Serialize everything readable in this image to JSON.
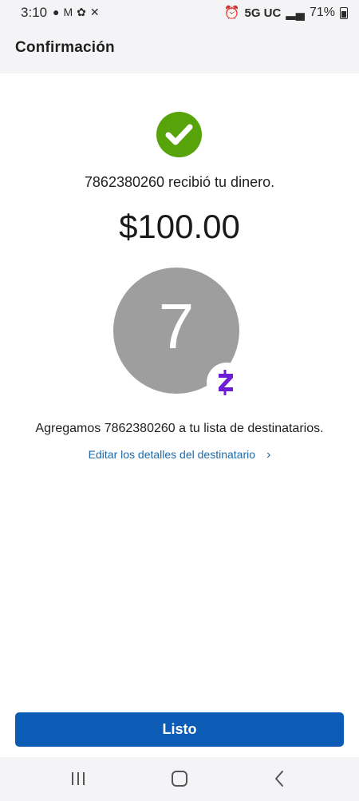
{
  "status_bar": {
    "time": "3:10",
    "network": "5G UC",
    "battery": "71%"
  },
  "header": {
    "title": "Confirmación"
  },
  "confirmation": {
    "received_text": "7862380260 recibió tu dinero.",
    "amount": "$100.00",
    "avatar_initial": "7",
    "added_text": "Agregamos 7862380260 a tu lista de destinatarios.",
    "edit_link": "Editar los detalles del destinatario",
    "done_button": "Listo"
  },
  "colors": {
    "success": "#56a30a",
    "primary": "#0c5bb5",
    "link": "#1e6aa8",
    "zelle_purple": "#6d1ed4",
    "avatar": "#9e9e9e"
  },
  "icons": {
    "check": "check-circle-icon",
    "zelle": "zelle-logo-icon",
    "chevron": "chevron-right-icon",
    "nav_recent": "recent-apps-icon",
    "nav_home": "home-icon",
    "nav_back": "back-icon"
  }
}
